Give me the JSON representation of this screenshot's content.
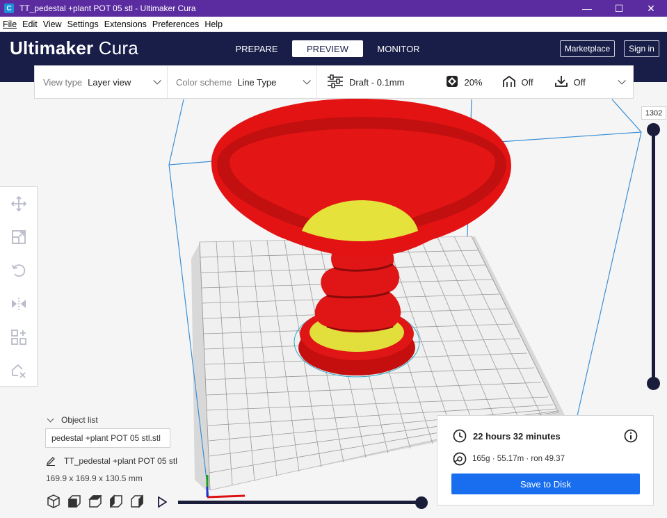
{
  "window": {
    "title": "TT_pedestal +plant POT 05 stl - Ultimaker Cura",
    "minimize": "—",
    "maximize": "☐",
    "close": "✕"
  },
  "menu": [
    "File",
    "Edit",
    "View",
    "Settings",
    "Extensions",
    "Preferences",
    "Help"
  ],
  "header": {
    "logo_bold": "Ultimaker",
    "logo_light": "Cura",
    "stages": [
      "PREPARE",
      "PREVIEW",
      "MONITOR"
    ],
    "active_stage": "PREVIEW",
    "marketplace": "Marketplace",
    "sign_in": "Sign in"
  },
  "toolbar": {
    "view_type_label": "View type",
    "view_type_value": "Layer view",
    "color_scheme_label": "Color scheme",
    "color_scheme_value": "Line Type",
    "profile": "Draft - 0.1mm",
    "infill": "20%",
    "support": "Off",
    "adhesion": "Off"
  },
  "layer_slider": {
    "max_layer": "1302"
  },
  "object_list": {
    "header": "Object list",
    "selected": "pedestal +plant POT 05 stl.stl",
    "object_name": "TT_pedestal +plant POT 05 stl",
    "dimensions": "169.9 x 169.9 x 130.5 mm"
  },
  "print_summary": {
    "time": "22 hours 32 minutes",
    "material": "165g · 55.17m · ron 49.37",
    "save_button": "Save to Disk"
  },
  "colors": {
    "titlebar": "#5b2ca0",
    "header": "#191e49",
    "accent_button": "#196ef0",
    "model_red": "#ee1111",
    "infill_yellow": "#e8e84a",
    "build_volume": "#3a8fd6"
  }
}
